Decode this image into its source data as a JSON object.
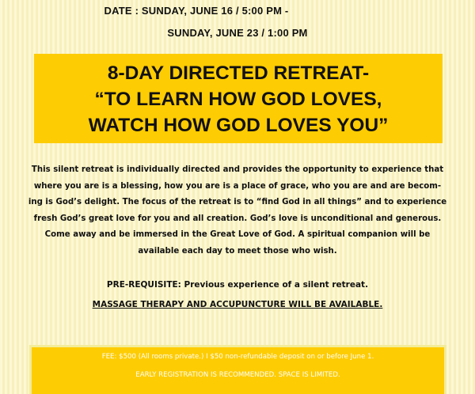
{
  "header": {
    "date_line_1": "DATE : SUNDAY, JUNE 16 / 5:00 PM -",
    "date_line_2": "SUNDAY,  JUNE 23 / 1:00 PM"
  },
  "title": {
    "line_1": "8-DAY DIRECTED RETREAT-",
    "line_2": "“TO LEARN HOW GOD LOVES,",
    "line_3": "WATCH HOW GOD LOVES YOU”"
  },
  "description": {
    "lines": [
      "This silent retreat is individually directed and provides the opportunity to experience that",
      "where you are is a blessing, how you are is a place of grace, who you are and are becom-",
      "ing is God’s delight. The focus of the retreat is to “find God in all things” and to experience",
      "fresh God’s great love for you and all creation. God’s love is unconditional and generous.",
      "Come away and be immersed in the Great Love of God. A spiritual companion will be",
      "available each day to meet those who wish."
    ]
  },
  "prerequisite": "PRE-REQUISITE: Previous experience of a silent retreat.",
  "amenities": "MASSAGE THERAPY AND ACCUPUNCTURE WILL BE AVAILABLE.",
  "fees": {
    "line_1": "FEE: $500 (All rooms private.) I $50 non-refundable deposit on or before June 1.",
    "line_2": "EARLY REGISTRATION IS RECOMMENDED. SPACE IS LIMITED."
  },
  "colors": {
    "title_background": "#fecc02",
    "page_background": "#fdf8d4",
    "fee_text": "#ffffff"
  }
}
